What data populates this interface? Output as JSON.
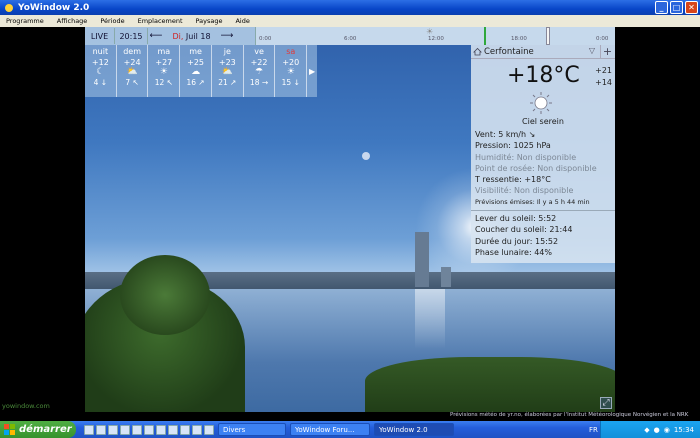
{
  "window": {
    "title": "YoWindow 2.0"
  },
  "menu": [
    "Programme",
    "Affichage",
    "Période",
    "Emplacement",
    "Paysage",
    "Aide"
  ],
  "topbar": {
    "live": "LIVE",
    "time": "20:15",
    "prev": "⟵",
    "date_day": "Di,",
    "date_rest": " Juil 18",
    "next": "⟶",
    "timeline_labels": [
      "0:00",
      "6:00",
      "12:00",
      "18:00",
      "0:00"
    ]
  },
  "forecast": [
    {
      "name": "nuit",
      "temp": "+12",
      "icon": "moon-icon",
      "glyph": "☾",
      "wind": "4 ↓",
      "weekend": false
    },
    {
      "name": "dem",
      "temp": "+24",
      "icon": "partly-cloudy-icon",
      "glyph": "⛅",
      "wind": "7 ↖",
      "weekend": false
    },
    {
      "name": "ma",
      "temp": "+27",
      "icon": "sun-icon",
      "glyph": "☀",
      "wind": "12 ↖",
      "weekend": false
    },
    {
      "name": "me",
      "temp": "+25",
      "icon": "cloud-icon",
      "glyph": "☁",
      "wind": "16 ↗",
      "weekend": false
    },
    {
      "name": "je",
      "temp": "+23",
      "icon": "partly-cloudy-icon",
      "glyph": "⛅",
      "wind": "21 ↗",
      "weekend": false
    },
    {
      "name": "ve",
      "temp": "+22",
      "icon": "rain-cloud-icon",
      "glyph": "☂",
      "wind": "18 →",
      "weekend": false
    },
    {
      "name": "sa",
      "temp": "+20",
      "icon": "sun-icon",
      "glyph": "☀",
      "wind": "15 ↓",
      "weekend": true
    }
  ],
  "panel": {
    "location": "Cerfontaine",
    "temp": "+18°C",
    "high": "+21",
    "low": "+14",
    "sky": "Ciel serein",
    "wind": "Vent:  5 km/h  ↘",
    "pressure": "Pression:  1025 hPa",
    "humidity": "Humidité:  Non disponible",
    "dewpoint": "Point de rosée:  Non disponible",
    "feels": "T ressentie:  +18°C",
    "visibility": "Visibilité:  Non disponible",
    "issued": "Prévisions émises:  Il y a 5 h 44 min",
    "sunrise": "Lever du soleil:   5:52",
    "sunset": "Coucher du soleil:   21:44",
    "daylength": "Durée du jour:   15:52",
    "moon": "Phase lunaire:   44%"
  },
  "credit": "yowindow.com",
  "credits_bar": "Prévisions météo de  yr.no, élaborées par l'Institut Météorologique Norvégien et la NRK",
  "taskbar": {
    "start": "démarrer",
    "tasks": [
      "Divers",
      "YoWindow Foru...",
      "YoWindow 2.0"
    ],
    "lang": "FR",
    "clock": "15:34"
  }
}
